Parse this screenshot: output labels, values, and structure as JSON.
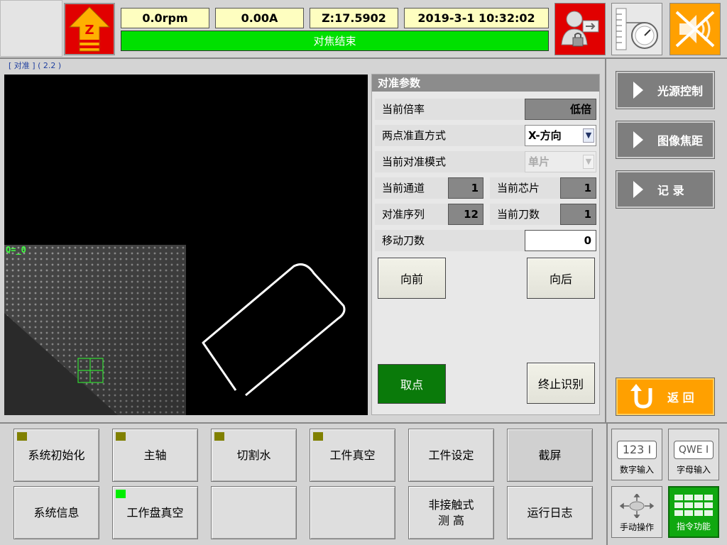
{
  "header": {
    "z_label": "Z",
    "rpm": "0.0rpm",
    "current": "0.00A",
    "z_pos": "Z:17.5902",
    "datetime": "2019-3-1 10:32:02",
    "status": "对焦结束",
    "status_color": "#00e000"
  },
  "breadcrumb": "[ 对准 ] ( 2.2 )",
  "camera": {
    "q_label": "Q=_0"
  },
  "params": {
    "title": "对准参数",
    "magnification_label": "当前倍率",
    "magnification_value": "低倍",
    "two_point_label": "两点准直方式",
    "two_point_value": "X-方向",
    "align_mode_label": "当前对准模式",
    "align_mode_value": "单片",
    "channel_label": "当前通道",
    "channel_value": "1",
    "chip_label": "当前芯片",
    "chip_value": "1",
    "sequence_label": "对准序列",
    "sequence_value": "12",
    "blade_label": "当前刀数",
    "blade_value": "1",
    "move_label": "移动刀数",
    "move_value": "0",
    "forward": "向前",
    "backward": "向后",
    "pick": "取点",
    "stop": "终止识别"
  },
  "right_menu": {
    "light": "光源控制",
    "focus": "图像焦距",
    "record": "记 录",
    "back": "返 回"
  },
  "bottom": {
    "init": "系统初始化",
    "spindle": "主轴",
    "water": "切割水",
    "vacuum": "工件真空",
    "setting": "工件设定",
    "screenshot": "截屏",
    "info": "系统信息",
    "table_vacuum": "工作盘真空",
    "noncontact_1": "非接触式",
    "noncontact_2": "测 高",
    "log": "运行日志"
  },
  "input_panel": {
    "num_icon": "123",
    "num": "数字输入",
    "alpha_icon": "QWE",
    "alpha": "字母输入",
    "manual": "手动操作",
    "command": "指令功能"
  },
  "colors": {
    "accent_red": "#e10000",
    "status_green": "#00e000",
    "pick_green": "#0a7a0a",
    "back_orange": "#ffa000",
    "indicator_olive": "#808000",
    "indicator_green": "#00ee00"
  }
}
